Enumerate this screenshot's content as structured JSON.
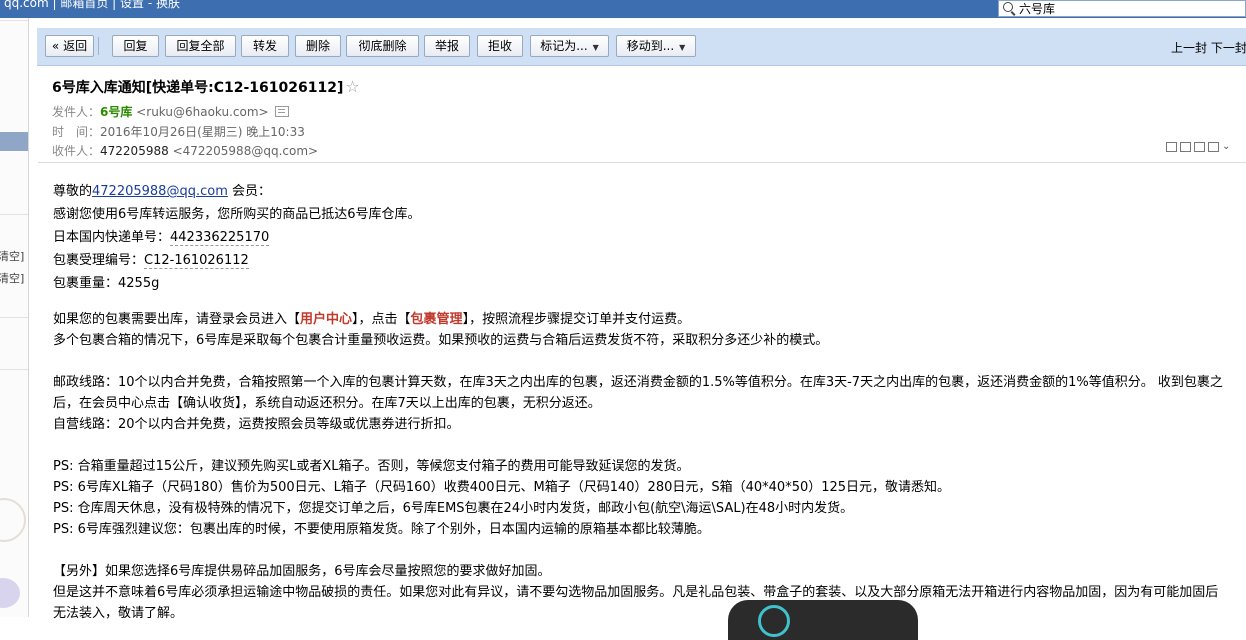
{
  "topbar": {
    "text": "qq.com  |  邮箱首页 | 设置 - 换肤",
    "search_value": "六号库"
  },
  "sidebar": {
    "clear_labels": [
      "清空]",
      "清空]"
    ]
  },
  "toolbar": {
    "back": "« 返回",
    "reply": "回复",
    "reply_all": "回复全部",
    "forward": "转发",
    "delete": "删除",
    "delete_permanently": "彻底删除",
    "report": "举报",
    "reject": "拒收",
    "mark_as": "标记为...",
    "move_to": "移动到...",
    "prev_next": "上一封 下一封"
  },
  "header": {
    "subject": "6号库入库通知[快递单号:C12-161026112]",
    "sender_label": "发件人：",
    "sender_name": "6号库",
    "sender_email": "<ruku@6haoku.com>",
    "time_label": "时　间：",
    "time_value": "2016年10月26日(星期三) 晚上10:33",
    "recipient_label": "收件人：",
    "recipient_name": "472205988",
    "recipient_email": "<472205988@qq.com>"
  },
  "body": {
    "greet_prefix": "尊敬的",
    "greet_email": "472205988@qq.com",
    "greet_suffix": " 会员：",
    "line1": "感谢您使用6号库转运服务，您所购买的商品已抵达6号库仓库。",
    "tracking_label": "日本国内快递单号：",
    "tracking_no": "442336225170",
    "package_label": "包裹受理编号：",
    "package_no": "C12-161026112",
    "weight_label": "包裹重量：",
    "weight": "4255g",
    "p1_a": "如果您的包裹需要出库，请登录会员进入【",
    "p1_link1": "用户中心",
    "p1_b": "】，点击【",
    "p1_link2": "包裹管理",
    "p1_c": "】，按照流程步骤提交订单并支付运费。",
    "p1_line2": "多个包裹合箱的情况下，6号库是采取每个包裹合计重量预收运费。如果预收的运费与合箱后运费发货不符，采取积分多还少补的模式。",
    "p2_line1": "邮政线路：10个以内合并免费，合箱按照第一个入库的包裹计算天数，在库3天之内出库的包裹，返还消费金额的1.5%等值积分。在库3天-7天之内出库的包裹，返还消费金额的1%等值积分。 收到包裹之后，在会员中心点击【确认收货】，系统自动返还积分。在库7天以上出库的包裹，无积分返还。",
    "p2_line2": "自营线路：20个以内合并免费，运费按照会员等级或优惠券进行折扣。",
    "ps1": "PS: 合箱重量超过15公斤，建议预先购买L或者XL箱子。否则，等候您支付箱子的费用可能导致延误您的发货。",
    "ps2": "PS: 6号库XL箱子（尺码180）售价为500日元、L箱子（尺码160）收费400日元、M箱子（尺码140）280日元，S箱（40*40*50）125日元，敬请悉知。",
    "ps3": "PS: 仓库周天休息，没有极特殊的情况下，您提交订单之后，6号库EMS包裹在24小时内发货，邮政小包(航空\\海运\\SAL)在48小时内发货。",
    "ps4": "PS: 6号库强烈建议您：包裹出库的时候，不要使用原箱发货。除了个别外，日本国内运输的原箱基本都比较薄脆。",
    "extra1": "【另外】如果您选择6号库提供易碎品加固服务，6号库会尽量按照您的要求做好加固。",
    "extra2": "但是这并不意味着6号库必须承担运输途中物品破损的责任。如果您对此有异议，请不要勾选物品加固服务。凡是礼品包装、带盒子的套装、以及大部分原箱无法开箱进行内容物品加固，因为有可能加固后无法装入，敬请了解。"
  }
}
